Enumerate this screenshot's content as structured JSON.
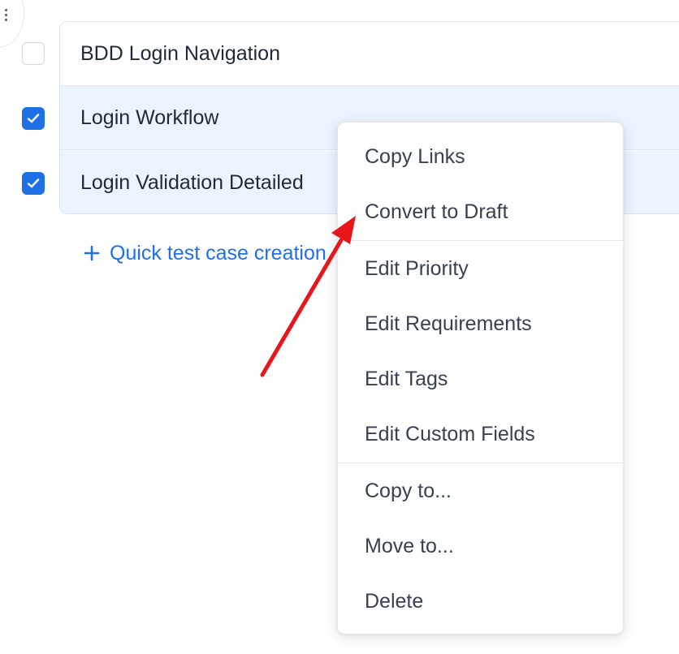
{
  "test_cases": [
    {
      "title": "BDD Login Navigation",
      "checked": false
    },
    {
      "title": "Login Workflow",
      "checked": true
    },
    {
      "title": "Login Validation Detailed",
      "checked": true
    }
  ],
  "quick_create": {
    "label": "Quick test case creation",
    "icon": "plus-icon"
  },
  "context_menu": {
    "groups": [
      [
        "Copy Links",
        "Convert to Draft"
      ],
      [
        "Edit Priority",
        "Edit Requirements",
        "Edit Tags",
        "Edit Custom Fields"
      ],
      [
        "Copy to...",
        "Move to...",
        "Delete"
      ]
    ]
  },
  "colors": {
    "accent": "#1f6fe5",
    "selected_row": "#eaf3fe",
    "annotation_arrow": "#e8161b"
  }
}
